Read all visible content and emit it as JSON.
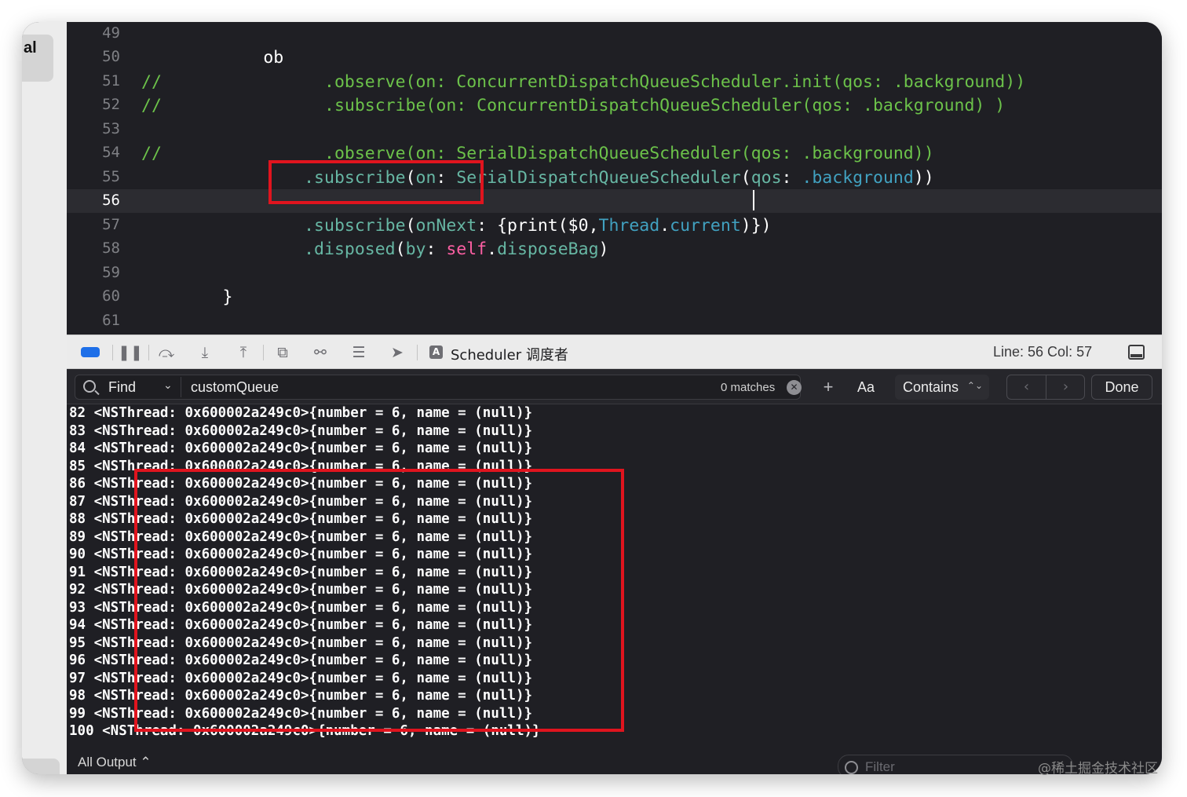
{
  "side_tab": {
    "label": "al"
  },
  "editor": {
    "lines": [
      {
        "num": "49"
      },
      {
        "num": "50",
        "text": "            ob"
      },
      {
        "num": "51",
        "comment": "//",
        "text": "                .observe(on: ConcurrentDispatchQueueScheduler.init(qos: .background))"
      },
      {
        "num": "52",
        "comment": "//",
        "text": "                .subscribe(on: ConcurrentDispatchQueueScheduler(qos: .background) )"
      },
      {
        "num": "53"
      },
      {
        "num": "54",
        "comment": "//",
        "text": "                .observe(on: SerialDispatchQueueScheduler(qos: .background))"
      },
      {
        "num": "55",
        "indent": "                ",
        "method": ".subscribe",
        "p1": "(",
        "label": "on",
        "p2": ": ",
        "type": "SerialDispatchQueueScheduler",
        "p3": "(",
        "label2": "qos",
        "p4": ": ",
        "prop": ".background",
        "p5": "))"
      },
      {
        "num": "56",
        "current": true
      },
      {
        "num": "57",
        "indent": "                ",
        "method": ".subscribe",
        "p1": "(",
        "label": "onNext",
        "p2": ": {print($0,",
        "type": "Thread",
        "p3": ".",
        "prop": "current",
        "p4": ")})"
      },
      {
        "num": "58",
        "indent": "                ",
        "method": ".disposed",
        "p1": "(",
        "label": "by",
        "p2": ": ",
        "kw": "self",
        "p3": ".",
        "prop": "disposeBag",
        "p4": ")"
      },
      {
        "num": "59"
      },
      {
        "num": "60",
        "text": "        }"
      },
      {
        "num": "61"
      }
    ]
  },
  "debug_bar": {
    "scheme_label": "Scheduler 调度者",
    "line_col": "Line: 56  Col: 57",
    "icons": [
      "breakpoints-toggle-icon",
      "pause-icon",
      "step-over-icon",
      "step-into-icon",
      "step-out-icon",
      "view-hierarchy-icon",
      "memory-graph-icon",
      "environment-overrides-icon",
      "simulate-location-icon",
      "app-icon",
      "panel-toggle-icon"
    ]
  },
  "find_bar": {
    "mode": "Find",
    "query": "customQueue",
    "matches": "0 matches",
    "case_button": "Aa",
    "match_type": "Contains",
    "done": "Done"
  },
  "console": {
    "lines": [
      "82 <NSThread: 0x600002a249c0>{number = 6, name = (null)}",
      "83 <NSThread: 0x600002a249c0>{number = 6, name = (null)}",
      "84 <NSThread: 0x600002a249c0>{number = 6, name = (null)}",
      "85 <NSThread: 0x600002a249c0>{number = 6, name = (null)}",
      "86 <NSThread: 0x600002a249c0>{number = 6, name = (null)}",
      "87 <NSThread: 0x600002a249c0>{number = 6, name = (null)}",
      "88 <NSThread: 0x600002a249c0>{number = 6, name = (null)}",
      "89 <NSThread: 0x600002a249c0>{number = 6, name = (null)}",
      "90 <NSThread: 0x600002a249c0>{number = 6, name = (null)}",
      "91 <NSThread: 0x600002a249c0>{number = 6, name = (null)}",
      "92 <NSThread: 0x600002a249c0>{number = 6, name = (null)}",
      "93 <NSThread: 0x600002a249c0>{number = 6, name = (null)}",
      "94 <NSThread: 0x600002a249c0>{number = 6, name = (null)}",
      "95 <NSThread: 0x600002a249c0>{number = 6, name = (null)}",
      "96 <NSThread: 0x600002a249c0>{number = 6, name = (null)}",
      "97 <NSThread: 0x600002a249c0>{number = 6, name = (null)}",
      "98 <NSThread: 0x600002a249c0>{number = 6, name = (null)}",
      "99 <NSThread: 0x600002a249c0>{number = 6, name = (null)}",
      "100 <NSThread: 0x600002a249c0>{number = 6, name = (null)}"
    ],
    "output_selector": "All Output ⌃",
    "filter_placeholder": "Filter"
  },
  "watermark": "@稀土掘金技术社区",
  "colors": {
    "editor_bg": "#1f1f24",
    "comment": "#6cc24a",
    "method": "#67b7a4",
    "type": "#5dd8ff",
    "property": "#41a1c0",
    "keyword": "#fc5fa3",
    "annotation_box": "#e0141e",
    "toolbar_accent": "#1e6fe8"
  }
}
